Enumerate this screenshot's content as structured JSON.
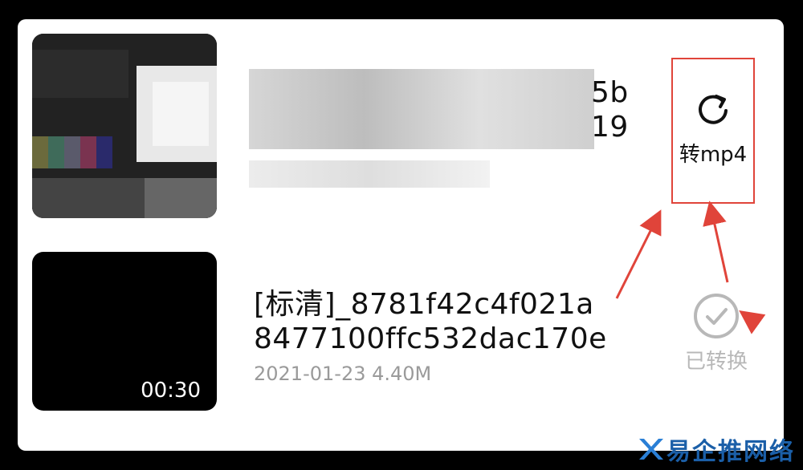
{
  "items": [
    {
      "title_line1": "5b",
      "title_line2": "19",
      "meta": "",
      "blurred": true,
      "action": {
        "label": "转mp4",
        "icon": "refresh-icon"
      }
    },
    {
      "title_line1": "[标清]_8781f42c4f021a",
      "title_line2": "8477100ffc532dac170e",
      "meta": "2021-01-23 4.40M",
      "duration": "00:30",
      "action": {
        "label": "已转换",
        "icon": "check-circle-icon"
      }
    }
  ],
  "watermark": {
    "text": "易企推网络"
  },
  "colors": {
    "highlight": "#e0443a",
    "converted": "#b8b8b8",
    "meta": "#9a9a9a"
  }
}
